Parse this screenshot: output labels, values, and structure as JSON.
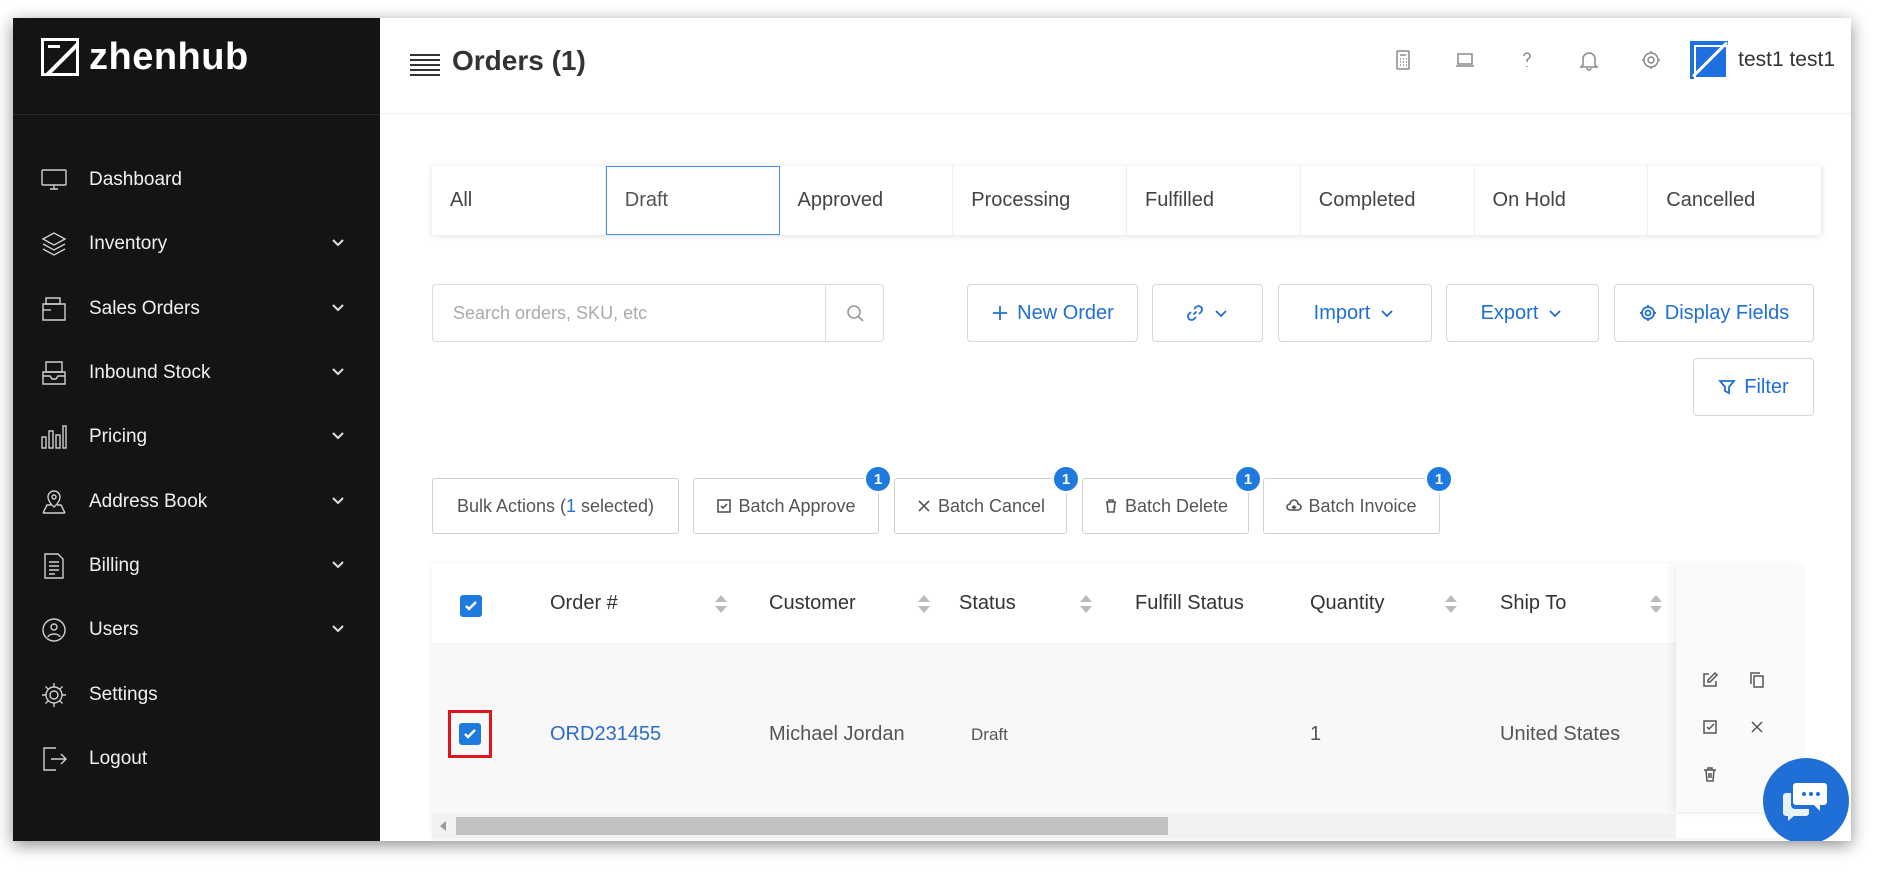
{
  "app": {
    "brand": "zhenhub"
  },
  "sidebar": {
    "items": [
      {
        "label": "Dashboard",
        "icon": "monitor-icon",
        "expandable": false
      },
      {
        "label": "Inventory",
        "icon": "layers-icon",
        "expandable": true
      },
      {
        "label": "Sales Orders",
        "icon": "orders-icon",
        "expandable": true
      },
      {
        "label": "Inbound Stock",
        "icon": "inbox-icon",
        "expandable": true
      },
      {
        "label": "Pricing",
        "icon": "bar-chart-icon",
        "expandable": true
      },
      {
        "label": "Address Book",
        "icon": "map-pin-icon",
        "expandable": true
      },
      {
        "label": "Billing",
        "icon": "document-icon",
        "expandable": true
      },
      {
        "label": "Users",
        "icon": "globe-user-icon",
        "expandable": true
      },
      {
        "label": "Settings",
        "icon": "gear-icon",
        "expandable": false
      },
      {
        "label": "Logout",
        "icon": "logout-icon",
        "expandable": false
      }
    ]
  },
  "header": {
    "title": "Orders (1)",
    "user_name": "test1 test1",
    "icons": [
      "calculator-icon",
      "laptop-icon",
      "help-icon",
      "bell-icon",
      "gear-icon"
    ]
  },
  "tabs": [
    {
      "label": "All",
      "active": false
    },
    {
      "label": "Draft",
      "active": true
    },
    {
      "label": "Approved",
      "active": false
    },
    {
      "label": "Processing",
      "active": false
    },
    {
      "label": "Fulfilled",
      "active": false
    },
    {
      "label": "Completed",
      "active": false
    },
    {
      "label": "On Hold",
      "active": false
    },
    {
      "label": "Cancelled",
      "active": false
    }
  ],
  "toolbar": {
    "search_placeholder": "Search orders, SKU, etc",
    "search_value": "",
    "new_order": "New Order",
    "import": "Import",
    "export": "Export",
    "display_fields": "Display Fields",
    "filter": "Filter"
  },
  "bulk": {
    "prefix": "Bulk Actions (",
    "count": "1",
    "suffix": " selected)",
    "batch_approve": "Batch Approve",
    "batch_cancel": "Batch Cancel",
    "batch_delete": "Batch Delete",
    "batch_invoice": "Batch Invoice",
    "badge": "1"
  },
  "table": {
    "columns": [
      "Order #",
      "Customer",
      "Status",
      "Fulfill Status",
      "Quantity",
      "Ship To"
    ],
    "rows": [
      {
        "order": "ORD231455",
        "customer": "Michael Jordan",
        "status": "Draft",
        "fulfill_status": "",
        "quantity": "1",
        "ship_to": "United States",
        "selected": true
      }
    ]
  },
  "colors": {
    "sidebar_bg": "#141414",
    "accent": "#1f6fd6",
    "highlight": "#e0141e"
  }
}
